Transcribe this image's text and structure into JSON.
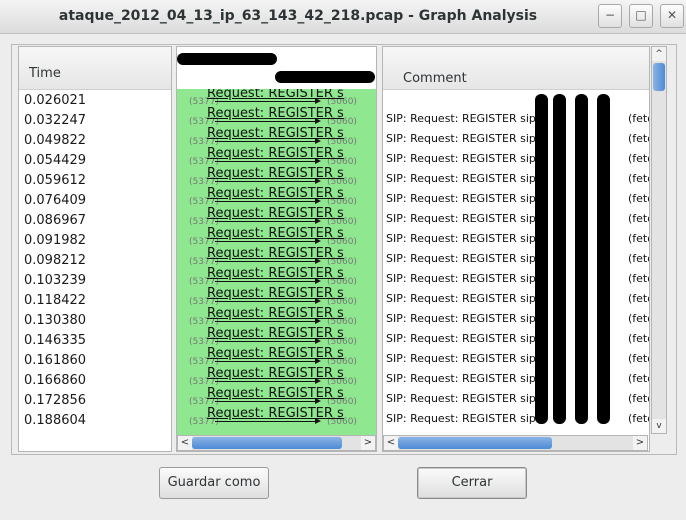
{
  "window": {
    "title": "ataque_2012_04_13_ip_63_143_42_218.pcap - Graph Analysis",
    "controls": {
      "minimize": "−",
      "maximize": "□",
      "close": "✕"
    }
  },
  "time_column": {
    "header": "Time",
    "values": [
      "0.026021",
      "0.032247",
      "0.049822",
      "0.054429",
      "0.059612",
      "0.076409",
      "0.086967",
      "0.091982",
      "0.098212",
      "0.103239",
      "0.118422",
      "0.130380",
      "0.146335",
      "0.161860",
      "0.166860",
      "0.172856",
      "0.188604"
    ]
  },
  "graph_column": {
    "rows": [
      {
        "label": "Request: REGISTER s",
        "src_port": "(5377)",
        "dst_port": "(5060)"
      },
      {
        "label": "Request: REGISTER s",
        "src_port": "(5377)",
        "dst_port": "(5060)"
      },
      {
        "label": "Request: REGISTER s",
        "src_port": "(5377)",
        "dst_port": "(5060)"
      },
      {
        "label": "Request: REGISTER s",
        "src_port": "(5377)",
        "dst_port": "(5060)"
      },
      {
        "label": "Request: REGISTER s",
        "src_port": "(5377)",
        "dst_port": "(5060)"
      },
      {
        "label": "Request: REGISTER s",
        "src_port": "(5377)",
        "dst_port": "(5060)"
      },
      {
        "label": "Request: REGISTER s",
        "src_port": "(5377)",
        "dst_port": "(5060)"
      },
      {
        "label": "Request: REGISTER s",
        "src_port": "(5377)",
        "dst_port": "(5060)"
      },
      {
        "label": "Request: REGISTER s",
        "src_port": "(5377)",
        "dst_port": "(5060)"
      },
      {
        "label": "Request: REGISTER s",
        "src_port": "(5377)",
        "dst_port": "(5060)"
      },
      {
        "label": "Request: REGISTER s",
        "src_port": "(5377)",
        "dst_port": "(5060)"
      },
      {
        "label": "Request: REGISTER s",
        "src_port": "(5377)",
        "dst_port": "(5060)"
      },
      {
        "label": "Request: REGISTER s",
        "src_port": "(5377)",
        "dst_port": "(5060)"
      },
      {
        "label": "Request: REGISTER s",
        "src_port": "(5377)",
        "dst_port": "(5060)"
      },
      {
        "label": "Request: REGISTER s",
        "src_port": "(5377)",
        "dst_port": "(5060)"
      },
      {
        "label": "Request: REGISTER s",
        "src_port": "(5377)",
        "dst_port": "(5060)"
      },
      {
        "label": "Request: REGISTER s",
        "src_port": "(5377)",
        "dst_port": "(5060)"
      }
    ],
    "fill_color": "#8fe88f"
  },
  "comment_column": {
    "header": "Comment",
    "rows": [
      {
        "text": "SIP: Request: REGISTER sip:",
        "trail": "(feto"
      },
      {
        "text": "SIP: Request: REGISTER sip:",
        "trail": "(feto"
      },
      {
        "text": "SIP: Request: REGISTER sip:",
        "trail": "(feto"
      },
      {
        "text": "SIP: Request: REGISTER sip:",
        "trail": "(feto"
      },
      {
        "text": "SIP: Request: REGISTER sip:",
        "trail": "(feto"
      },
      {
        "text": "SIP: Request: REGISTER sip:",
        "trail": "(feto"
      },
      {
        "text": "SIP: Request: REGISTER sip:",
        "trail": "(feto"
      },
      {
        "text": "SIP: Request: REGISTER sip:",
        "trail": "(feto"
      },
      {
        "text": "SIP: Request: REGISTER sip:",
        "trail": "(feto"
      },
      {
        "text": "SIP: Request: REGISTER sip:",
        "trail": "(feto"
      },
      {
        "text": "SIP: Request: REGISTER sip:",
        "trail": "(feto"
      },
      {
        "text": "SIP: Request: REGISTER sip:",
        "trail": "(feto"
      },
      {
        "text": "SIP: Request: REGISTER sip:",
        "trail": "(feto"
      },
      {
        "text": "SIP: Request: REGISTER sip:",
        "trail": "(feto"
      },
      {
        "text": "SIP: Request: REGISTER sip:",
        "trail": "(feto"
      },
      {
        "text": "SIP: Request: REGISTER sip:",
        "trail": "(feto"
      }
    ]
  },
  "buttons": {
    "save_as": "Guardar como",
    "close": "Cerrar"
  },
  "scroll": {
    "h_left": "<",
    "h_right": ">",
    "v_up": "^",
    "v_down": "v",
    "grip": "III"
  }
}
